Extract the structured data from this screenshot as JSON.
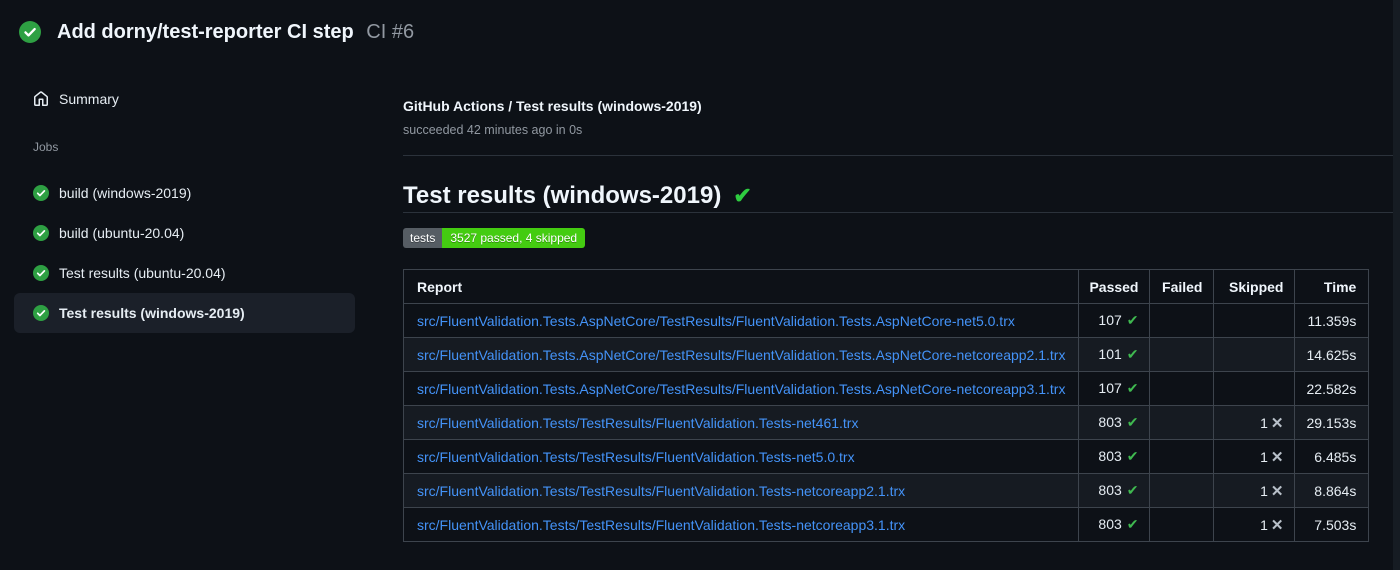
{
  "header": {
    "title": "Add dorny/test-reporter CI step",
    "run_number": "CI #6",
    "status": "success"
  },
  "sidebar": {
    "summary_label": "Summary",
    "jobs_label": "Jobs",
    "jobs": [
      {
        "label": "build (windows-2019)",
        "status": "success",
        "selected": false
      },
      {
        "label": "build (ubuntu-20.04)",
        "status": "success",
        "selected": false
      },
      {
        "label": "Test results (ubuntu-20.04)",
        "status": "success",
        "selected": false
      },
      {
        "label": "Test results (windows-2019)",
        "status": "success",
        "selected": true
      }
    ]
  },
  "main": {
    "job_title": "GitHub Actions / Test results (windows-2019)",
    "job_subtitle": "succeeded 42 minutes ago in 0s",
    "heading": "Test results (windows-2019)",
    "badge": {
      "label": "tests",
      "value": "3527 passed, 4 skipped"
    },
    "table": {
      "columns": [
        "Report",
        "Passed",
        "Failed",
        "Skipped",
        "Time"
      ],
      "rows": [
        {
          "report": "src/FluentValidation.Tests.AspNetCore/TestResults/FluentValidation.Tests.AspNetCore-net5.0.trx",
          "passed": "107",
          "failed": "",
          "skipped": "",
          "time": "11.359s"
        },
        {
          "report": "src/FluentValidation.Tests.AspNetCore/TestResults/FluentValidation.Tests.AspNetCore-netcoreapp2.1.trx",
          "passed": "101",
          "failed": "",
          "skipped": "",
          "time": "14.625s"
        },
        {
          "report": "src/FluentValidation.Tests.AspNetCore/TestResults/FluentValidation.Tests.AspNetCore-netcoreapp3.1.trx",
          "passed": "107",
          "failed": "",
          "skipped": "",
          "time": "22.582s"
        },
        {
          "report": "src/FluentValidation.Tests/TestResults/FluentValidation.Tests-net461.trx",
          "passed": "803",
          "failed": "",
          "skipped": "1",
          "time": "29.153s"
        },
        {
          "report": "src/FluentValidation.Tests/TestResults/FluentValidation.Tests-net5.0.trx",
          "passed": "803",
          "failed": "",
          "skipped": "1",
          "time": "6.485s"
        },
        {
          "report": "src/FluentValidation.Tests/TestResults/FluentValidation.Tests-netcoreapp2.1.trx",
          "passed": "803",
          "failed": "",
          "skipped": "1",
          "time": "8.864s"
        },
        {
          "report": "src/FluentValidation.Tests/TestResults/FluentValidation.Tests-netcoreapp3.1.trx",
          "passed": "803",
          "failed": "",
          "skipped": "1",
          "time": "7.503s"
        }
      ]
    }
  },
  "icons": {
    "run_status": "check-circle-icon",
    "summary": "home-icon",
    "job_status": "check-circle-icon",
    "check_glyph": "✔",
    "x_glyph": "✕",
    "heading_check_glyph": "✔"
  },
  "colors": {
    "background": "#0d1117",
    "success_green": "#3fb950",
    "job_icon_green": "#2ea043",
    "link_blue": "#4493f8",
    "badge_label_bg": "#565d64",
    "badge_value_bg": "#44cc11",
    "muted_text": "#9198a1",
    "table_border": "#3d444d",
    "row_alt_bg": "#161b22",
    "selected_item_bg": "#1b2029"
  }
}
